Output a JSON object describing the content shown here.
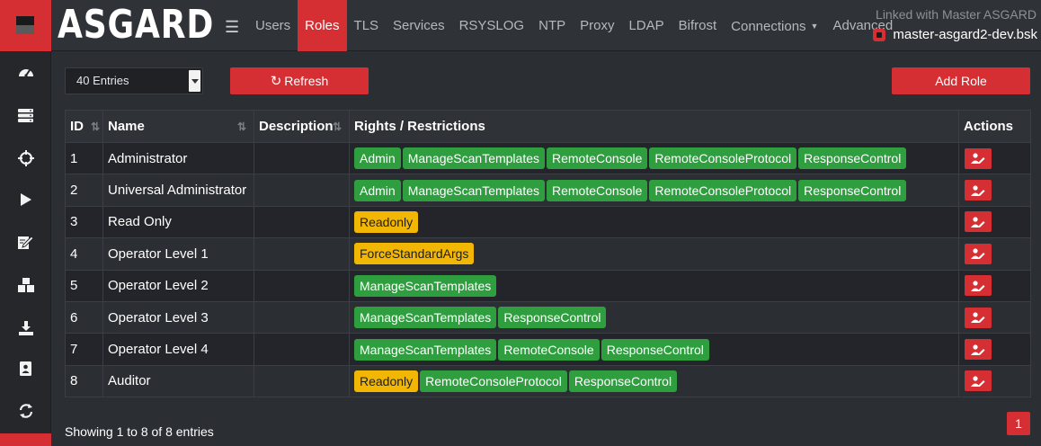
{
  "brand": "ASGARD",
  "nav": {
    "items": [
      {
        "label": "Users",
        "active": false
      },
      {
        "label": "Roles",
        "active": true
      },
      {
        "label": "TLS",
        "active": false
      },
      {
        "label": "Services",
        "active": false
      },
      {
        "label": "RSYSLOG",
        "active": false
      },
      {
        "label": "NTP",
        "active": false
      },
      {
        "label": "Proxy",
        "active": false
      },
      {
        "label": "LDAP",
        "active": false
      },
      {
        "label": "Bifrost",
        "active": false
      },
      {
        "label": "Connections",
        "active": false,
        "dropdown": true
      },
      {
        "label": "Advanced",
        "active": false
      }
    ]
  },
  "header": {
    "linked_label": "Linked with Master ASGARD",
    "master_host": "master-asgard2-dev.bsk"
  },
  "sidebar": {
    "icons": [
      "dashboard-icon",
      "servers-icon",
      "crosshair-icon",
      "play-icon",
      "edit-document-icon",
      "boxes-icon",
      "download-icon",
      "id-badge-icon",
      "sync-icon"
    ]
  },
  "controls": {
    "entries_value": "40 Entries",
    "refresh_label": "Refresh",
    "add_role_label": "Add Role"
  },
  "table": {
    "headers": {
      "id": "ID",
      "name": "Name",
      "description": "Description",
      "rights": "Rights / Restrictions",
      "actions": "Actions"
    },
    "rows": [
      {
        "id": "1",
        "name": "Administrator",
        "description": "",
        "rights": [
          {
            "label": "Admin",
            "color": "green"
          },
          {
            "label": "ManageScanTemplates",
            "color": "green"
          },
          {
            "label": "RemoteConsole",
            "color": "green"
          },
          {
            "label": "RemoteConsoleProtocol",
            "color": "green"
          },
          {
            "label": "ResponseControl",
            "color": "green"
          }
        ]
      },
      {
        "id": "2",
        "name": "Universal Administrator",
        "description": "",
        "rights": [
          {
            "label": "Admin",
            "color": "green"
          },
          {
            "label": "ManageScanTemplates",
            "color": "green"
          },
          {
            "label": "RemoteConsole",
            "color": "green"
          },
          {
            "label": "RemoteConsoleProtocol",
            "color": "green"
          },
          {
            "label": "ResponseControl",
            "color": "green"
          }
        ]
      },
      {
        "id": "3",
        "name": "Read Only",
        "description": "",
        "rights": [
          {
            "label": "Readonly",
            "color": "yellow"
          }
        ]
      },
      {
        "id": "4",
        "name": "Operator Level 1",
        "description": "",
        "rights": [
          {
            "label": "ForceStandardArgs",
            "color": "yellow"
          }
        ]
      },
      {
        "id": "5",
        "name": "Operator Level 2",
        "description": "",
        "rights": [
          {
            "label": "ManageScanTemplates",
            "color": "green"
          }
        ]
      },
      {
        "id": "6",
        "name": "Operator Level 3",
        "description": "",
        "rights": [
          {
            "label": "ManageScanTemplates",
            "color": "green"
          },
          {
            "label": "ResponseControl",
            "color": "green"
          }
        ]
      },
      {
        "id": "7",
        "name": "Operator Level 4",
        "description": "",
        "rights": [
          {
            "label": "ManageScanTemplates",
            "color": "green"
          },
          {
            "label": "RemoteConsole",
            "color": "green"
          },
          {
            "label": "ResponseControl",
            "color": "green"
          }
        ]
      },
      {
        "id": "8",
        "name": "Auditor",
        "description": "",
        "rights": [
          {
            "label": "Readonly",
            "color": "yellow"
          },
          {
            "label": "RemoteConsoleProtocol",
            "color": "green"
          },
          {
            "label": "ResponseControl",
            "color": "green"
          }
        ]
      }
    ]
  },
  "footer": {
    "showing_text": "Showing 1 to 8 of 8 entries",
    "current_page": "1"
  },
  "colors": {
    "accent": "#d62f33",
    "badge_green": "#2e9e3f",
    "badge_yellow": "#f2b705",
    "background": "#2b2e33"
  }
}
